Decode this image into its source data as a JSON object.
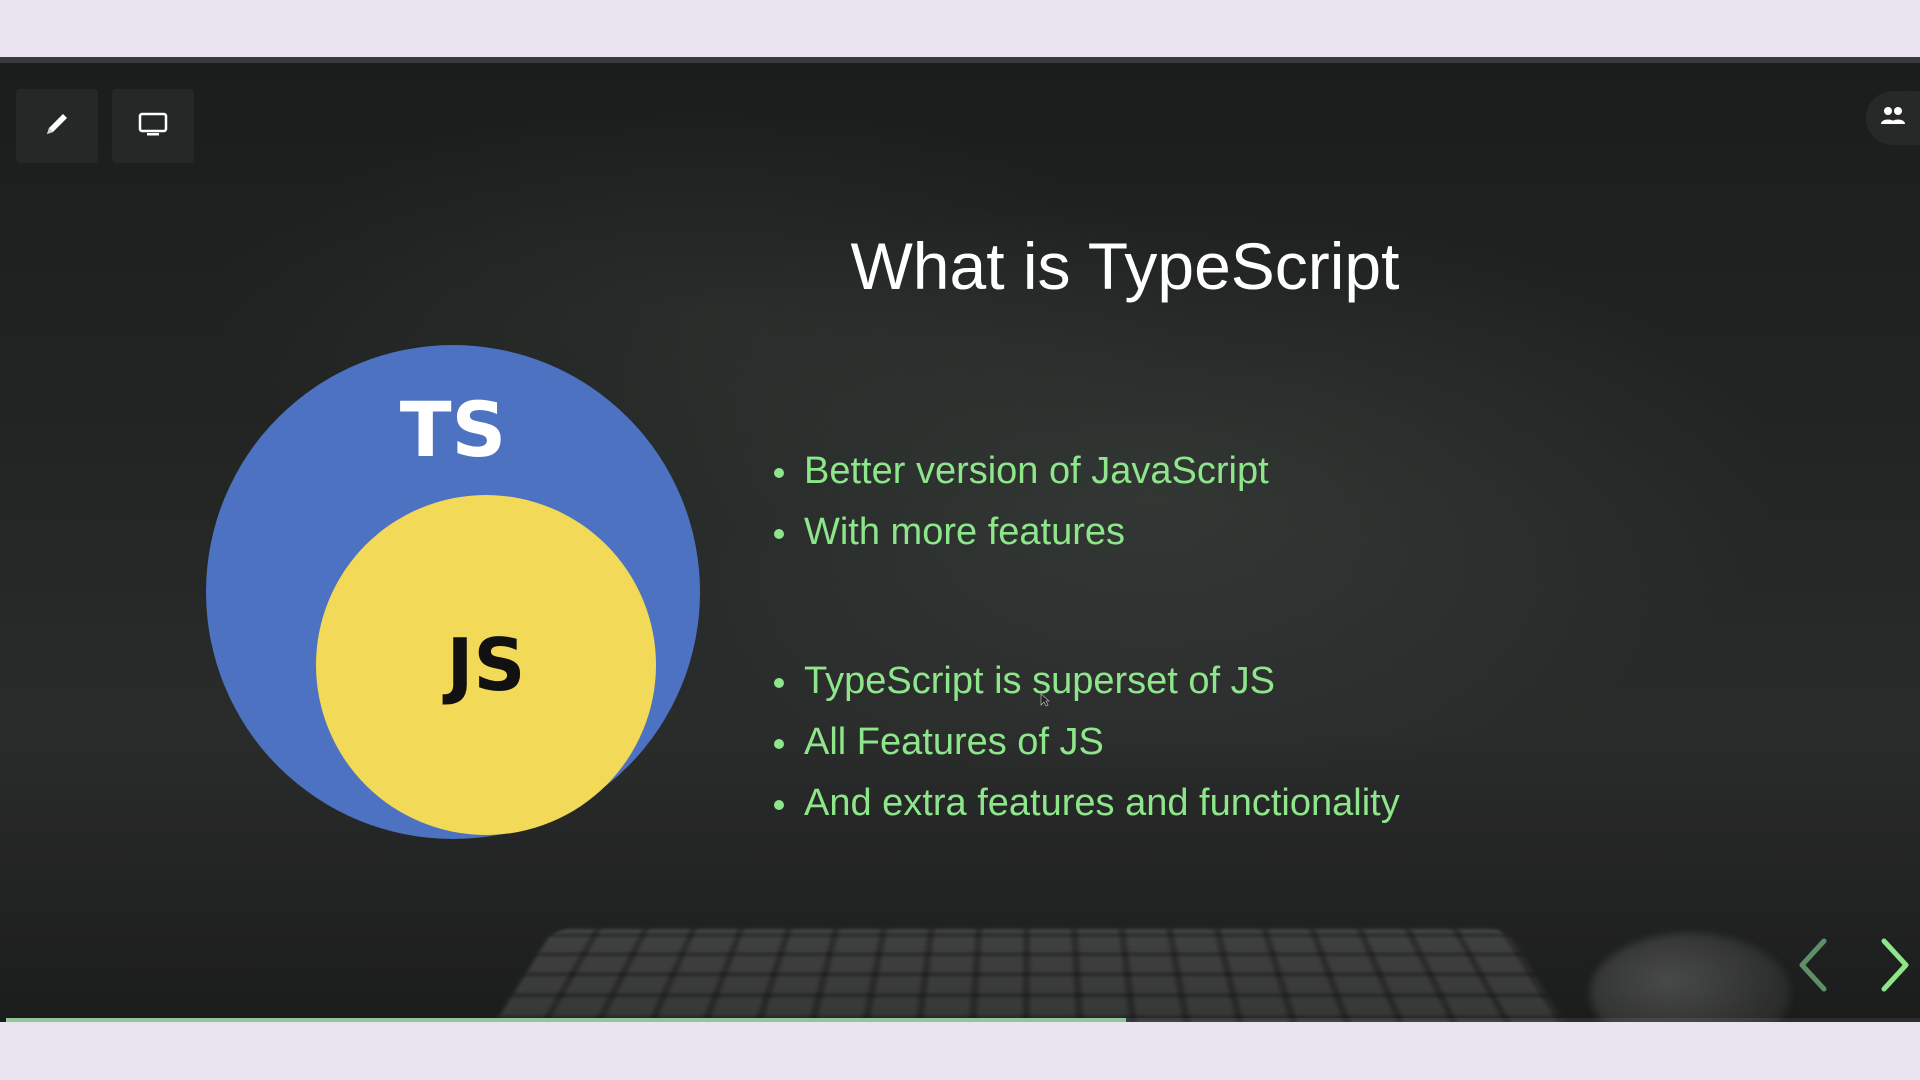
{
  "slide": {
    "title": "What is TypeScript",
    "bullets_group1": [
      "Better version of JavaScript",
      "With more features"
    ],
    "bullets_group2": [
      "TypeScript is superset of JS",
      "All Features of JS",
      "And extra features and functionality"
    ],
    "diagram": {
      "outer_label": "TS",
      "inner_label": "JS",
      "outer_color": "#4d72c2",
      "inner_color": "#f2d957"
    }
  },
  "toolbar": {
    "pen_icon": "pen-icon",
    "screen_icon": "monitor-icon"
  },
  "participants_icon": "people-icon",
  "navigation": {
    "prev_icon": "chevron-left-icon",
    "next_icon": "chevron-right-icon"
  },
  "progress": {
    "fraction": 0.585,
    "color": "#8fc69a"
  },
  "colors": {
    "bullet_text": "#8ee68a",
    "title_text": "#ffffff"
  }
}
